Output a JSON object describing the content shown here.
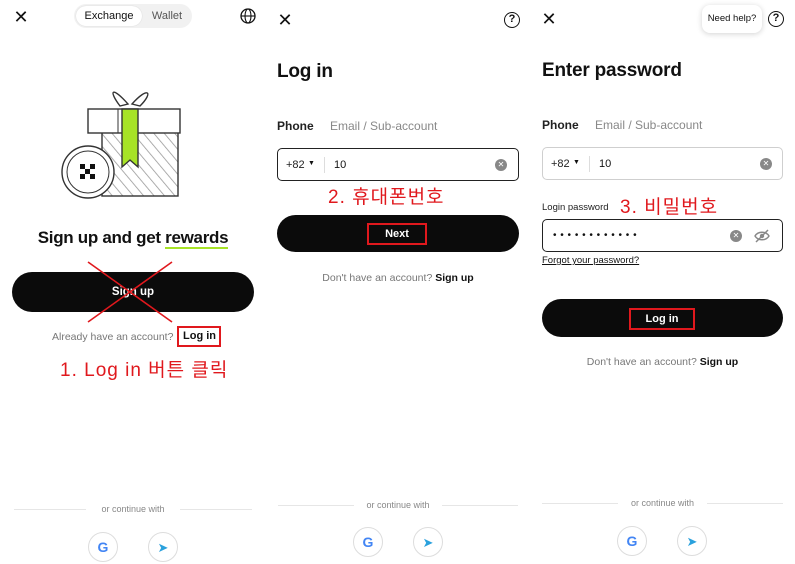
{
  "panel1": {
    "tabs": [
      "Exchange",
      "Wallet"
    ],
    "headline_prefix": "Sign up and get ",
    "headline_highlight": "rewards",
    "signup_button": "Sign up",
    "already_text": "Already have an account?",
    "login_link": "Log in",
    "annotation": "1. Log in 버튼 클릭",
    "continue_with": "or continue with",
    "icons": [
      "close-icon",
      "globe-icon",
      "gift-illustration",
      "google-icon",
      "telegram-icon"
    ]
  },
  "panel2": {
    "title": "Log in",
    "tab_phone": "Phone",
    "tab_email": "Email / Sub-account",
    "country_code": "+82",
    "phone_value": "10",
    "annotation": "2. 휴대폰번호",
    "next_button": "Next",
    "no_account_text": "Don't have an account?",
    "signup_link": "Sign up",
    "continue_with": "or continue with"
  },
  "panel3": {
    "need_help": "Need help?",
    "title": "Enter password",
    "tab_phone": "Phone",
    "tab_email": "Email / Sub-account",
    "country_code": "+82",
    "phone_value": "10",
    "password_label": "Login password",
    "annotation": "3. 비밀번호",
    "password_mask": "• • • • • • • • • • • •",
    "forgot_link": "Forgot your password?",
    "login_button": "Log in",
    "no_account_text": "Don't have an account?",
    "signup_link": "Sign up",
    "continue_with": "or continue with"
  },
  "colors": {
    "accent_green": "#a7e326",
    "annotation_red": "#e0181d",
    "button_black": "#0b0b0b"
  }
}
